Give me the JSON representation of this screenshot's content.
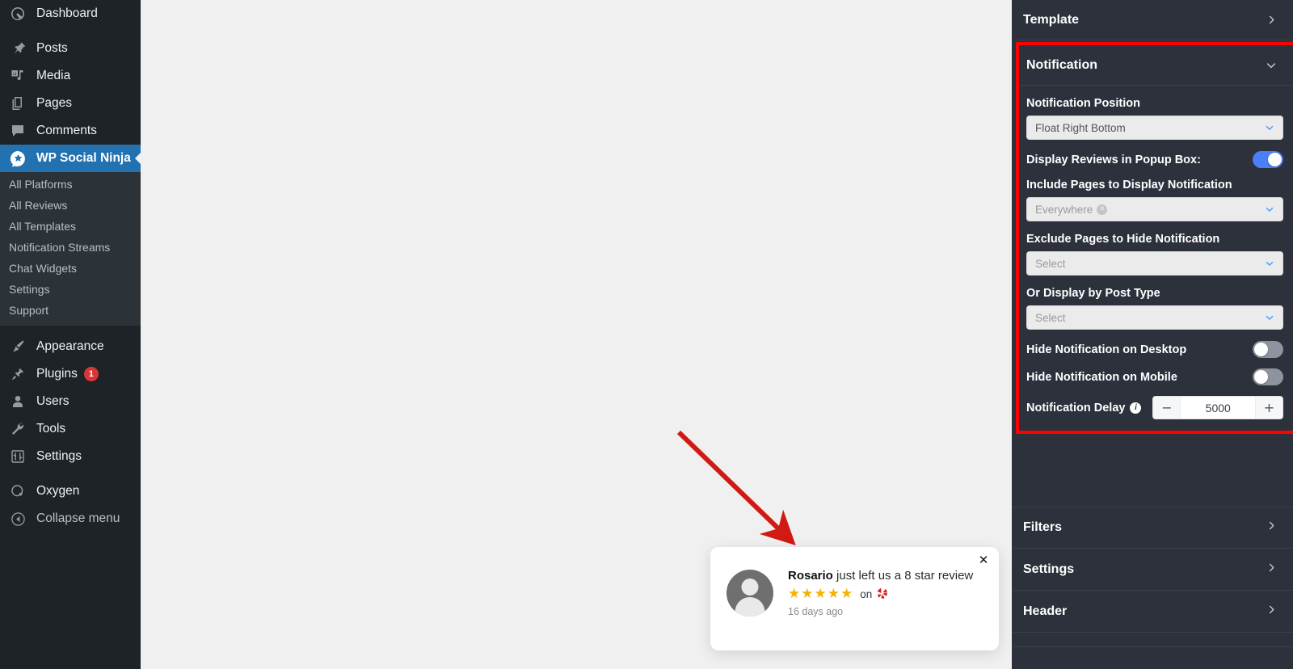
{
  "sidebar": {
    "items": [
      {
        "label": "Dashboard",
        "icon": "dashboard-icon"
      },
      {
        "label": "Posts",
        "icon": "pin-icon"
      },
      {
        "label": "Media",
        "icon": "media-icon"
      },
      {
        "label": "Pages",
        "icon": "pages-icon"
      },
      {
        "label": "Comments",
        "icon": "comments-icon"
      },
      {
        "label": "WP Social Ninja",
        "icon": "ninja-star-icon",
        "active": true
      }
    ],
    "submenu": [
      "All Platforms",
      "All Reviews",
      "All Templates",
      "Notification Streams",
      "Chat Widgets",
      "Settings",
      "Support"
    ],
    "items2": [
      {
        "label": "Appearance",
        "icon": "brush-icon"
      },
      {
        "label": "Plugins",
        "icon": "plug-icon",
        "badge": "1"
      },
      {
        "label": "Users",
        "icon": "user-icon"
      },
      {
        "label": "Tools",
        "icon": "wrench-icon"
      },
      {
        "label": "Settings",
        "icon": "sliders-icon"
      }
    ],
    "items3": [
      {
        "label": "Oxygen",
        "icon": "oxygen-icon"
      },
      {
        "label": "Collapse menu",
        "icon": "collapse-arrow-icon"
      }
    ]
  },
  "notification_popup": {
    "reviewer": "Rosario",
    "message": " just left us a 8 star review",
    "stars": "★★★★★",
    "on_label": "on",
    "platform_icon": "yelp-icon",
    "time": "16 days ago",
    "close_icon": "✕"
  },
  "right_panel": {
    "sections_before": [
      {
        "label": "Template",
        "chevron": "chevron-right-icon"
      }
    ],
    "notification_section": {
      "title": "Notification",
      "chevron": "chevron-down-icon",
      "fields": {
        "position_label": "Notification Position",
        "position_value": "Float Right Bottom",
        "display_popup_label": "Display Reviews in Popup Box:",
        "display_popup_on": true,
        "include_label": "Include Pages to Display Notification",
        "include_value": "Everywhere",
        "include_tag_remove": "✕",
        "exclude_label": "Exclude Pages to Hide Notification",
        "exclude_placeholder": "Select",
        "post_type_label": "Or Display by Post Type",
        "post_type_placeholder": "Select",
        "hide_desktop_label": "Hide Notification on Desktop",
        "hide_desktop_on": false,
        "hide_mobile_label": "Hide Notification on Mobile",
        "hide_mobile_on": false,
        "delay_label": "Notification Delay",
        "delay_info_icon": "info-icon",
        "delay_minus": "−",
        "delay_value": "5000",
        "delay_plus": "+"
      }
    },
    "sections_after": [
      {
        "label": "Filters",
        "chevron": "chevron-right-icon"
      },
      {
        "label": "Settings",
        "chevron": "chevron-right-icon"
      },
      {
        "label": "Header",
        "chevron": "chevron-right-icon"
      }
    ]
  },
  "annotations": {
    "highlight_color": "#fe0000",
    "arrow_color": "#d11a13"
  }
}
